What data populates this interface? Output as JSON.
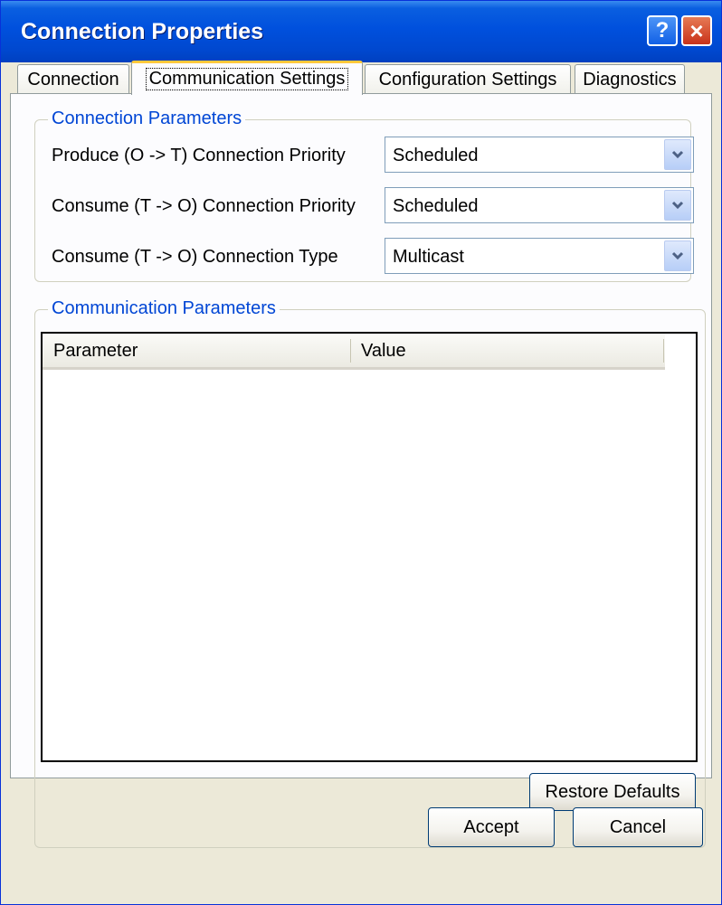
{
  "window": {
    "title": "Connection Properties"
  },
  "title_buttons": {
    "help": "?",
    "close": "×"
  },
  "tabs": [
    {
      "label": "Connection"
    },
    {
      "label": "Communication Settings"
    },
    {
      "label": "Configuration Settings"
    },
    {
      "label": "Diagnostics"
    }
  ],
  "connection_parameters": {
    "title": "Connection Parameters",
    "rows": [
      {
        "label": "Produce (O -> T) Connection Priority",
        "value": "Scheduled"
      },
      {
        "label": "Consume (T -> O) Connection Priority",
        "value": "Scheduled"
      },
      {
        "label": "Consume (T -> O) Connection Type",
        "value": "Multicast"
      }
    ]
  },
  "communication_parameters": {
    "title": "Communication Parameters",
    "columns": [
      "Parameter",
      "Value"
    ],
    "rows": [],
    "restore_label": "Restore Defaults"
  },
  "footer": {
    "accept_label": "Accept",
    "cancel_label": "Cancel"
  },
  "colors": {
    "title_bar": "#0050dd",
    "accent": "#0046d5",
    "active_tab_highlight": "#ffc83c"
  }
}
